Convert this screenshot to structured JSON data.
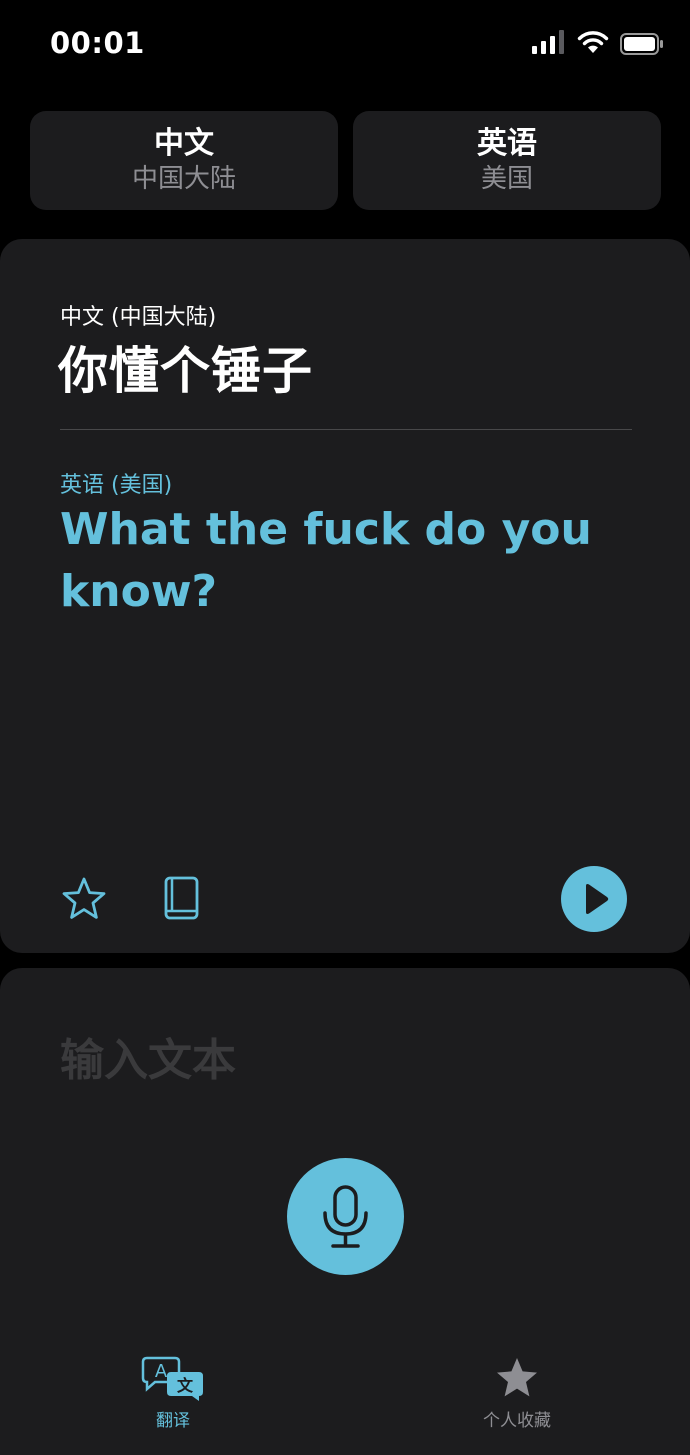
{
  "status_bar": {
    "time": "00:01"
  },
  "language_selector": {
    "source": {
      "name": "中文",
      "region": "中国大陆"
    },
    "target": {
      "name": "英语",
      "region": "美国"
    }
  },
  "translation": {
    "source_language_label": "中文 (中国大陆)",
    "source_text": "你懂个锤子",
    "target_language_label": "英语 (美国)",
    "target_text": "What the fuck do you know?"
  },
  "input": {
    "placeholder": "输入文本"
  },
  "tab_bar": {
    "translate_label": "翻译",
    "favorites_label": "个人收藏"
  },
  "colors": {
    "accent": "#64c0dc",
    "card_background": "#1c1c1e",
    "page_background": "#000000",
    "secondary_text": "#8e8e93"
  },
  "icons": {
    "signal": "cellular-signal-icon",
    "wifi": "wifi-icon",
    "battery": "battery-icon",
    "favorite": "star-outline-icon",
    "dictionary": "book-icon",
    "play": "play-icon",
    "microphone": "microphone-icon",
    "translate_tab": "translate-icon",
    "favorites_tab": "star-filled-icon"
  }
}
